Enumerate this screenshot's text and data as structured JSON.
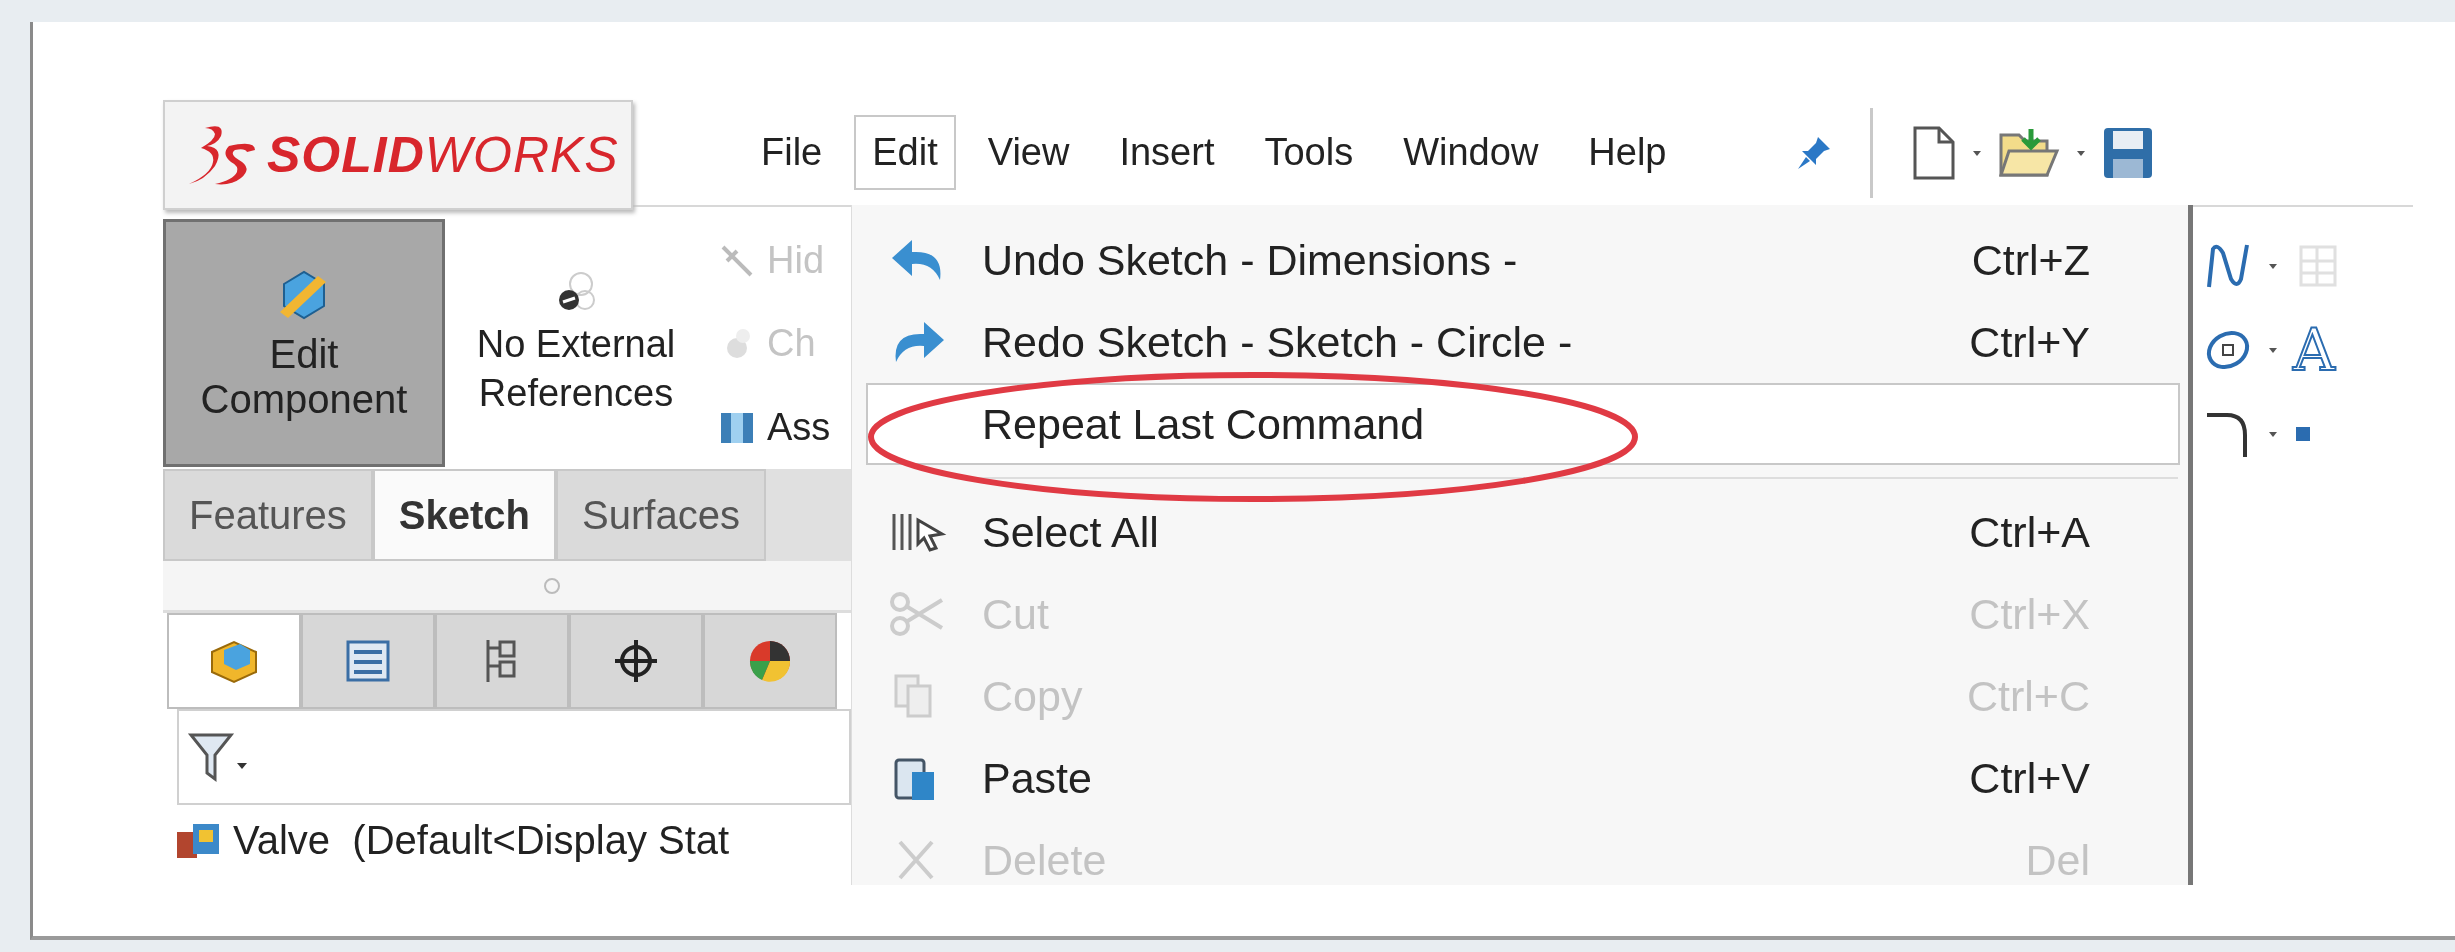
{
  "logo": {
    "wordmark": "**SOLID**WORKS"
  },
  "menu_bar": [
    {
      "label": "File",
      "selected": false
    },
    {
      "label": "Edit",
      "selected": true
    },
    {
      "label": "View",
      "selected": false
    },
    {
      "label": "Insert",
      "selected": false
    },
    {
      "label": "Tools",
      "selected": false
    },
    {
      "label": "Window",
      "selected": false
    },
    {
      "label": "Help",
      "selected": false
    }
  ],
  "ribbon": {
    "edit_component": {
      "label": "Edit Component",
      "pressed": true
    },
    "external_references": {
      "label": "No External References"
    },
    "small_tools": [
      {
        "label": "Hid",
        "disabled": true
      },
      {
        "label": "Ch",
        "disabled": true
      },
      {
        "label": "Ass",
        "disabled": false
      }
    ],
    "text_tool": "A"
  },
  "command_tabs": [
    {
      "label": "Features",
      "selected": false
    },
    {
      "label": "Sketch",
      "selected": true
    },
    {
      "label": "Surfaces",
      "selected": false
    }
  ],
  "panel_tabs": [
    {
      "selected": true
    },
    {
      "selected": false
    },
    {
      "selected": false
    },
    {
      "selected": false
    },
    {
      "selected": false
    }
  ],
  "tree": {
    "root": "Valve  (Default<Display Stat"
  },
  "edit_menu": [
    {
      "kind": "item",
      "label": "Undo Sketch - Dimensions -",
      "shortcut": "Ctrl+Z",
      "disabled": false,
      "selected": false
    },
    {
      "kind": "item",
      "label": "Redo Sketch - Sketch - Circle -",
      "shortcut": "Ctrl+Y",
      "disabled": false,
      "selected": false
    },
    {
      "kind": "item",
      "label": "Repeat Last Command",
      "disabled": false,
      "selected": true
    },
    {
      "kind": "separator"
    },
    {
      "kind": "item",
      "label": "Select All",
      "shortcut": "Ctrl+A",
      "disabled": false,
      "selected": false
    },
    {
      "kind": "item",
      "label": "Cut",
      "shortcut": "Ctrl+X",
      "disabled": true,
      "selected": false
    },
    {
      "kind": "item",
      "label": "Copy",
      "shortcut": "Ctrl+C",
      "disabled": true,
      "selected": false
    },
    {
      "kind": "item",
      "label": "Paste",
      "shortcut": "Ctrl+V",
      "disabled": false,
      "selected": false
    },
    {
      "kind": "item",
      "label": "Delete",
      "shortcut": "Del",
      "disabled": true,
      "selected": false
    }
  ]
}
